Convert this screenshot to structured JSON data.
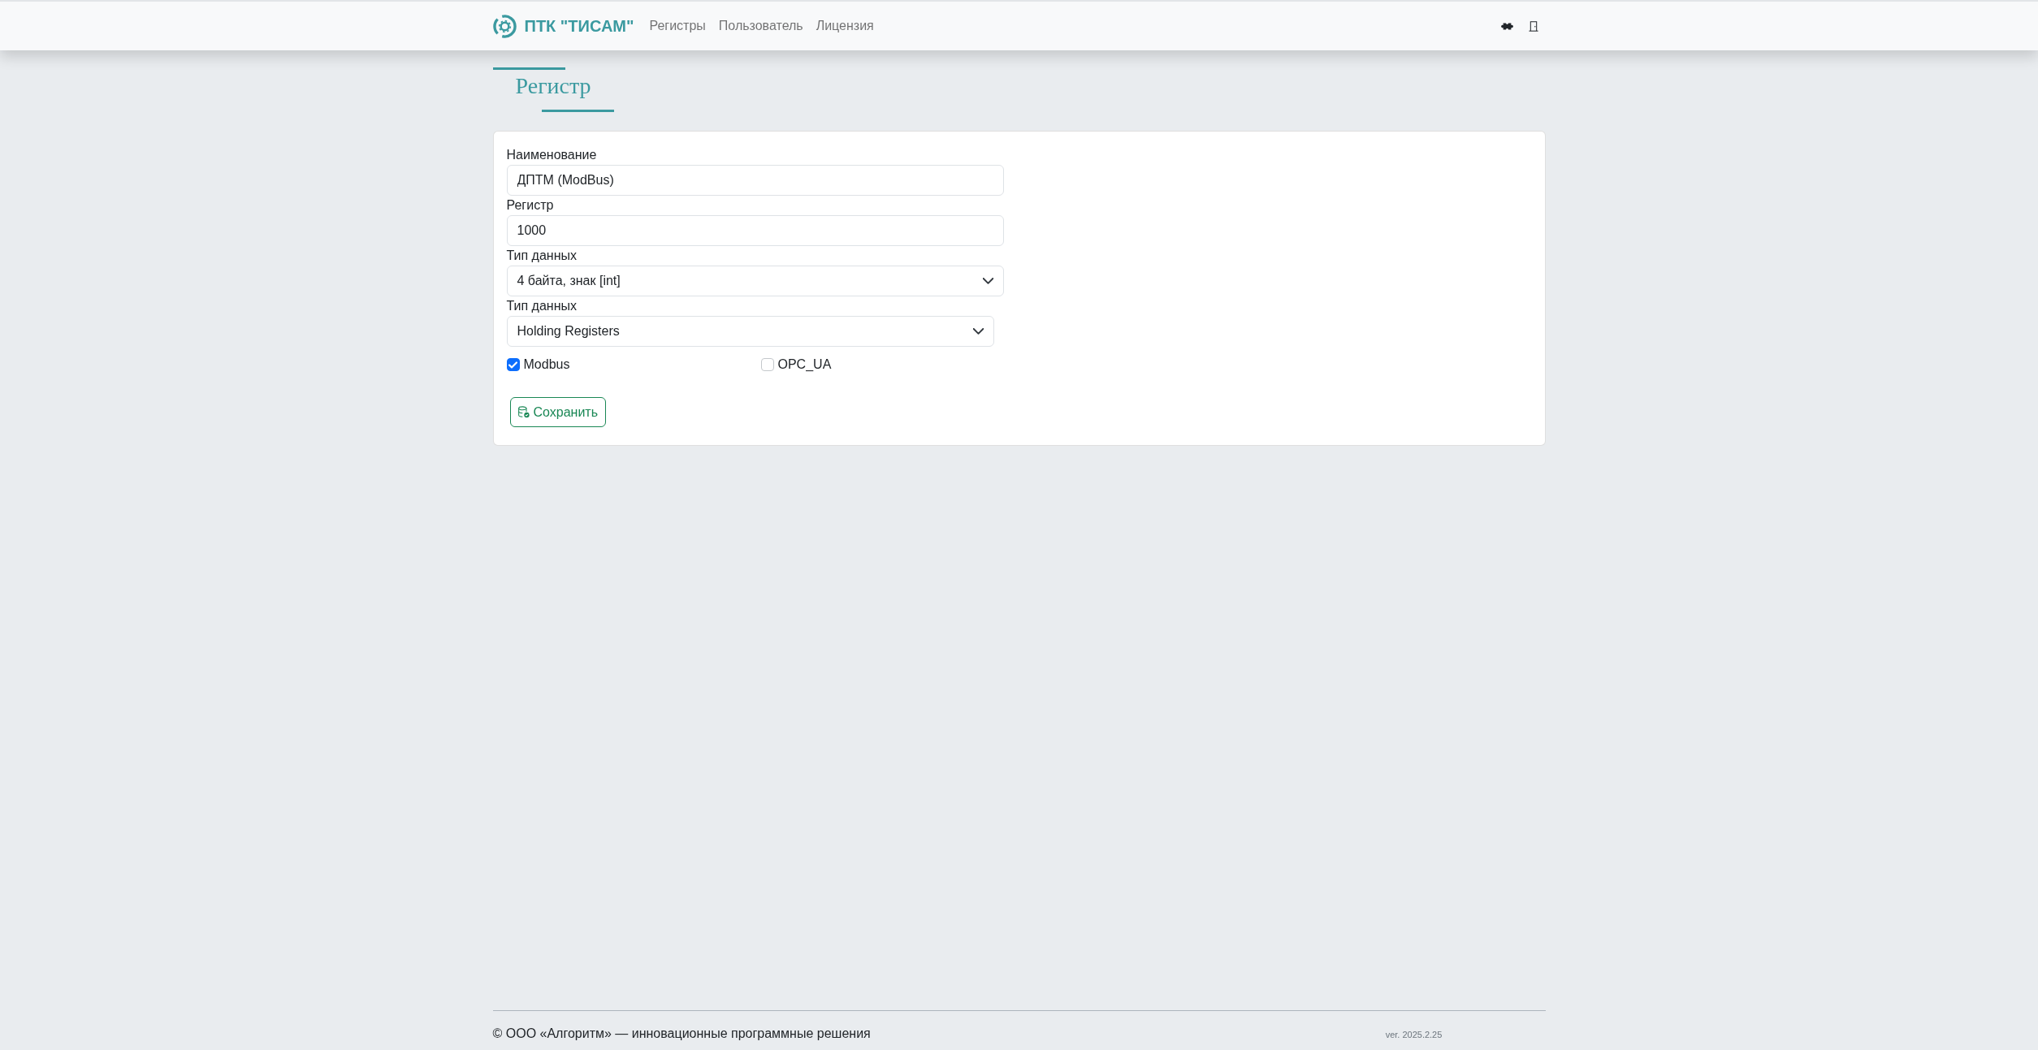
{
  "navbar": {
    "brand": "ПТК \"ТИСАМ\"",
    "links": [
      "Регистры",
      "Пользователь",
      "Лицензия"
    ]
  },
  "page_title": "Регистр",
  "form": {
    "fields": [
      {
        "kind": "text",
        "label": "Наименование",
        "value": "ДПТМ (ModBus)"
      },
      {
        "kind": "text",
        "label": "Регистр",
        "value": "1000"
      },
      {
        "kind": "select",
        "label": "Тип данных",
        "value": "4 байта, знак [int]"
      },
      {
        "kind": "select",
        "label": "Тип данных",
        "value": "Holding Registers"
      }
    ],
    "checkboxes": [
      {
        "label": "Modbus",
        "checked": true
      },
      {
        "label": "OPC_UA",
        "checked": false
      }
    ],
    "save_button": "Сохранить"
  },
  "footer": {
    "copyright": "© ООО «Алгоритм» — инновационные программные решения",
    "version": "ver. 2025.2.25"
  }
}
